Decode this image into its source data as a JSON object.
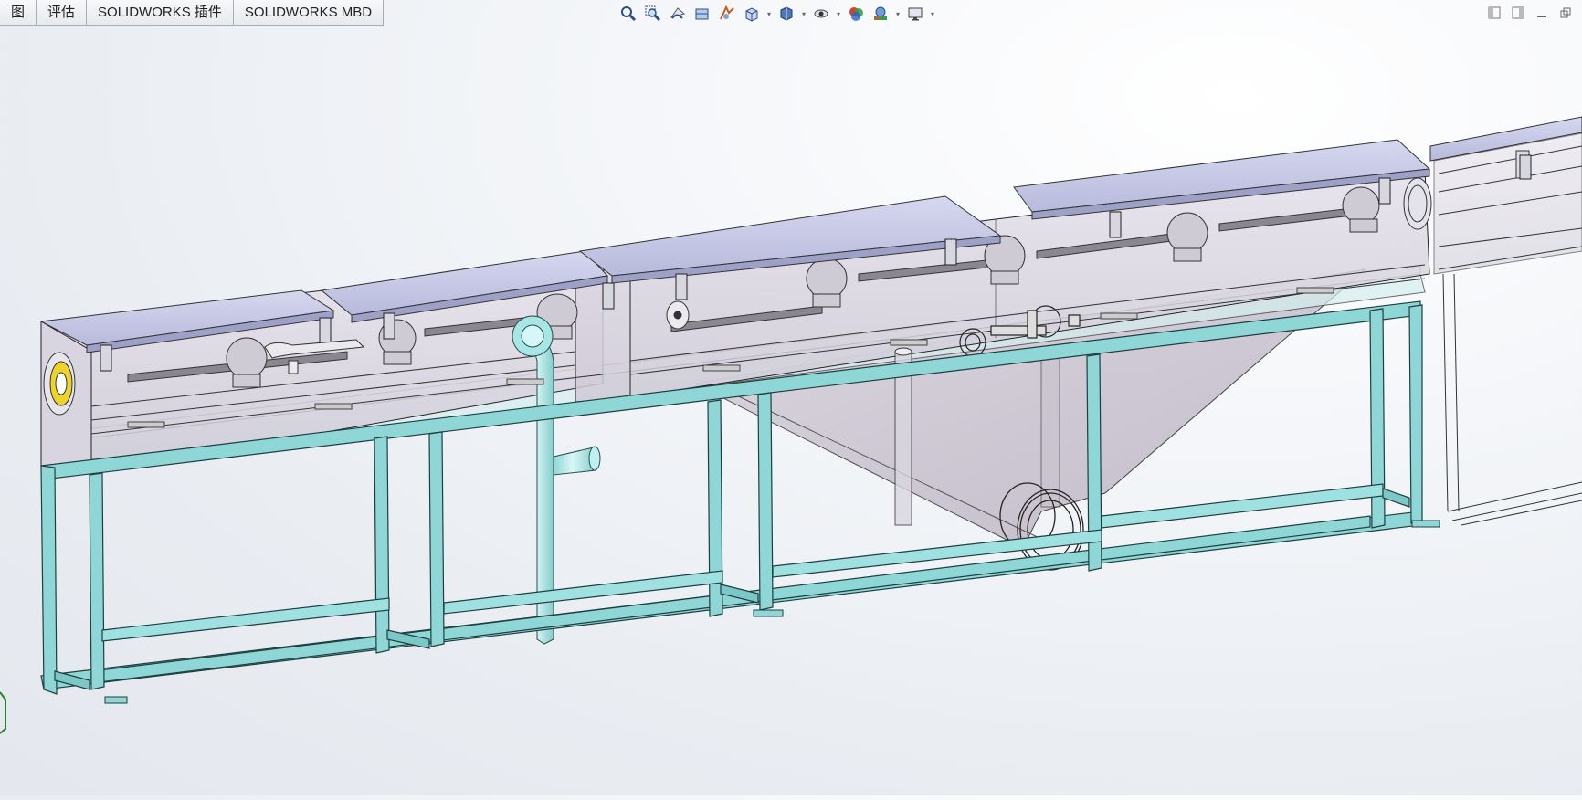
{
  "tabs": [
    {
      "label": "图"
    },
    {
      "label": "评估"
    },
    {
      "label": "SOLIDWORKS 插件"
    },
    {
      "label": "SOLIDWORKS MBD"
    }
  ],
  "view_toolbar": {
    "icons": [
      "zoom-to-fit-icon",
      "zoom-to-area-icon",
      "previous-view-icon",
      "section-view-icon",
      "dynamic-annotation-icon",
      "view-orientation-icon",
      "display-style-icon",
      "hide-show-items-icon",
      "edit-appearance-icon",
      "apply-scene-icon",
      "view-settings-icon"
    ]
  },
  "window_controls": {
    "icons": [
      "tile-left-icon",
      "tile-right-icon",
      "minimize-icon",
      "restore-icon"
    ]
  },
  "colors": {
    "frame": "#8fd3d3",
    "frame_edge": "#1f3f3f",
    "cover": "#c9cbe8",
    "glass": "#d9d6e2",
    "pipe": "#b8ecec"
  }
}
